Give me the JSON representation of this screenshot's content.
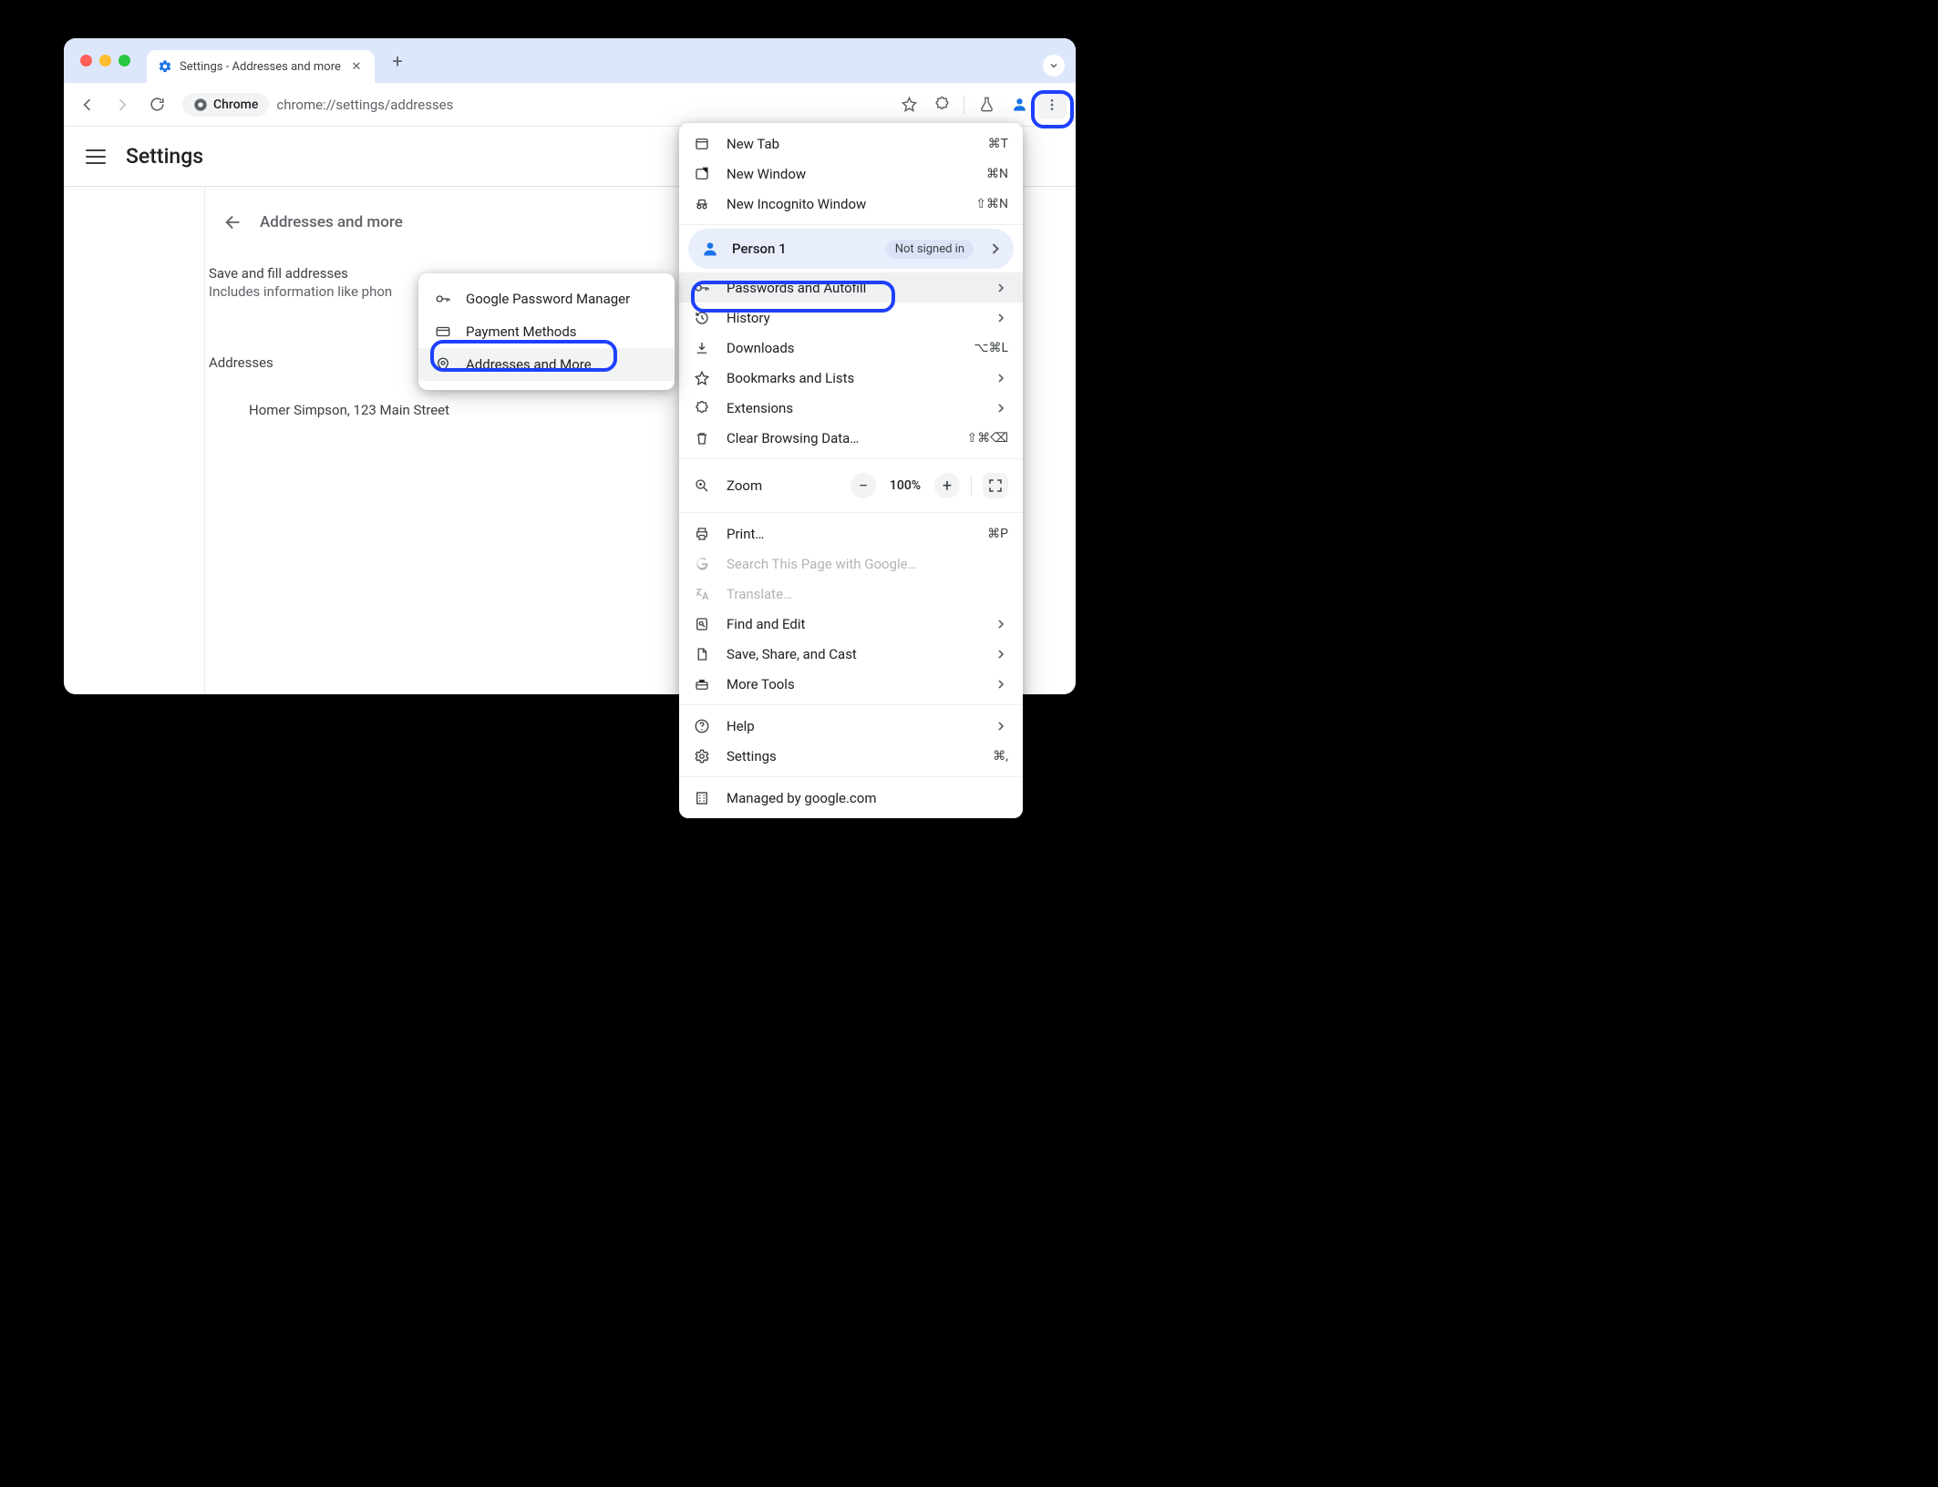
{
  "tab": {
    "title": "Settings - Addresses and more"
  },
  "toolbar": {
    "chrome_label": "Chrome",
    "url": "chrome://settings/addresses"
  },
  "header": {
    "title": "Settings"
  },
  "subheader": {
    "title": "Addresses and more"
  },
  "save_fill": {
    "title": "Save and fill addresses",
    "subtitle": "Includes information like phon"
  },
  "addresses": {
    "label": "Addresses",
    "items": [
      "Homer Simpson, 123 Main Street"
    ]
  },
  "submenu": {
    "items": [
      {
        "label": "Google Password Manager"
      },
      {
        "label": "Payment Methods"
      },
      {
        "label": "Addresses and More"
      }
    ]
  },
  "menu": {
    "new_tab": "New Tab",
    "new_tab_accel": "⌘T",
    "new_window": "New Window",
    "new_window_accel": "⌘N",
    "new_incognito": "New Incognito Window",
    "new_incognito_accel": "⇧⌘N",
    "profile_name": "Person 1",
    "profile_status": "Not signed in",
    "passwords": "Passwords and Autofill",
    "history": "History",
    "downloads": "Downloads",
    "downloads_accel": "⌥⌘L",
    "bookmarks": "Bookmarks and Lists",
    "extensions": "Extensions",
    "clear": "Clear Browsing Data…",
    "clear_accel": "⇧⌘⌫",
    "zoom": "Zoom",
    "zoom_val": "100%",
    "print": "Print…",
    "print_accel": "⌘P",
    "search": "Search This Page with Google…",
    "translate": "Translate…",
    "find": "Find and Edit",
    "save_share": "Save, Share, and Cast",
    "more_tools": "More Tools",
    "help": "Help",
    "settings": "Settings",
    "settings_accel": "⌘,",
    "managed": "Managed by google.com"
  }
}
